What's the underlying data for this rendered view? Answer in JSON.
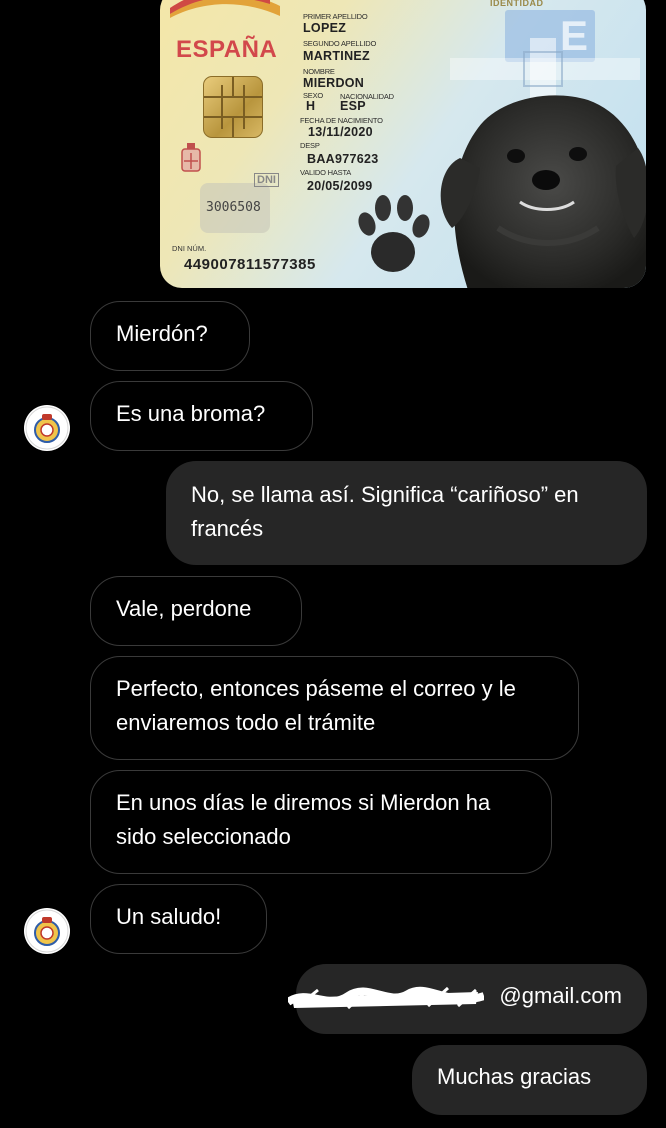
{
  "id_card": {
    "header_text": "DOCUMENTO NACIONAL DE IDENTIDAD",
    "country": "ESPAÑA",
    "fields": {
      "surname1_label": "PRIMER APELLIDO",
      "surname1": "LOPEZ",
      "surname2_label": "SEGUNDO APELLIDO",
      "surname2": "MARTINEZ",
      "name_label": "NOMBRE",
      "name": "MIERDON",
      "sex_label": "SEXO",
      "nationality_label": "NACIONALIDAD",
      "sex": "H",
      "nationality": "ESP",
      "dob_label": "FECHA DE NACIMIENTO",
      "dob": "13/11/2020",
      "desp_label": "DESP",
      "desp": "BAA977623",
      "valid_label": "VALIDO HASTA",
      "valid": "20/05/2099"
    },
    "stamp_number": "3006508",
    "dni_logo": "DNI",
    "dni_num_label": "DNI NÚM.",
    "dni_number": "449007811577385"
  },
  "messages": [
    {
      "id": "m1",
      "direction": "incoming",
      "text": "Mierdón?"
    },
    {
      "id": "m2",
      "direction": "incoming",
      "text": "Es una broma?"
    },
    {
      "id": "m3",
      "direction": "outgoing",
      "text": "No, se llama así. Significa “cariñoso” en francés"
    },
    {
      "id": "m4",
      "direction": "incoming",
      "text": "Vale, perdone"
    },
    {
      "id": "m5",
      "direction": "incoming",
      "text": "Perfecto, entonces páseme el correo y le enviaremos todo el trámite"
    },
    {
      "id": "m6",
      "direction": "incoming",
      "text": "En unos días le diremos si Mierdon ha sido seleccionado"
    },
    {
      "id": "m7",
      "direction": "incoming",
      "text": "Un saludo!"
    },
    {
      "id": "m8",
      "direction": "outgoing",
      "text": "@gmail.com"
    },
    {
      "id": "m9",
      "direction": "outgoing",
      "text": "Muchas gracias"
    }
  ],
  "colors": {
    "background": "#000000",
    "outgoing_bubble": "#262626",
    "incoming_border": "#3a3a3a",
    "text": "#ffffff",
    "espana_red": "#d2484b"
  },
  "icons": {
    "avatar": "coat-of-arms-badge-icon",
    "card_chip": "chip-icon",
    "pawprint": "paw-print-icon"
  }
}
